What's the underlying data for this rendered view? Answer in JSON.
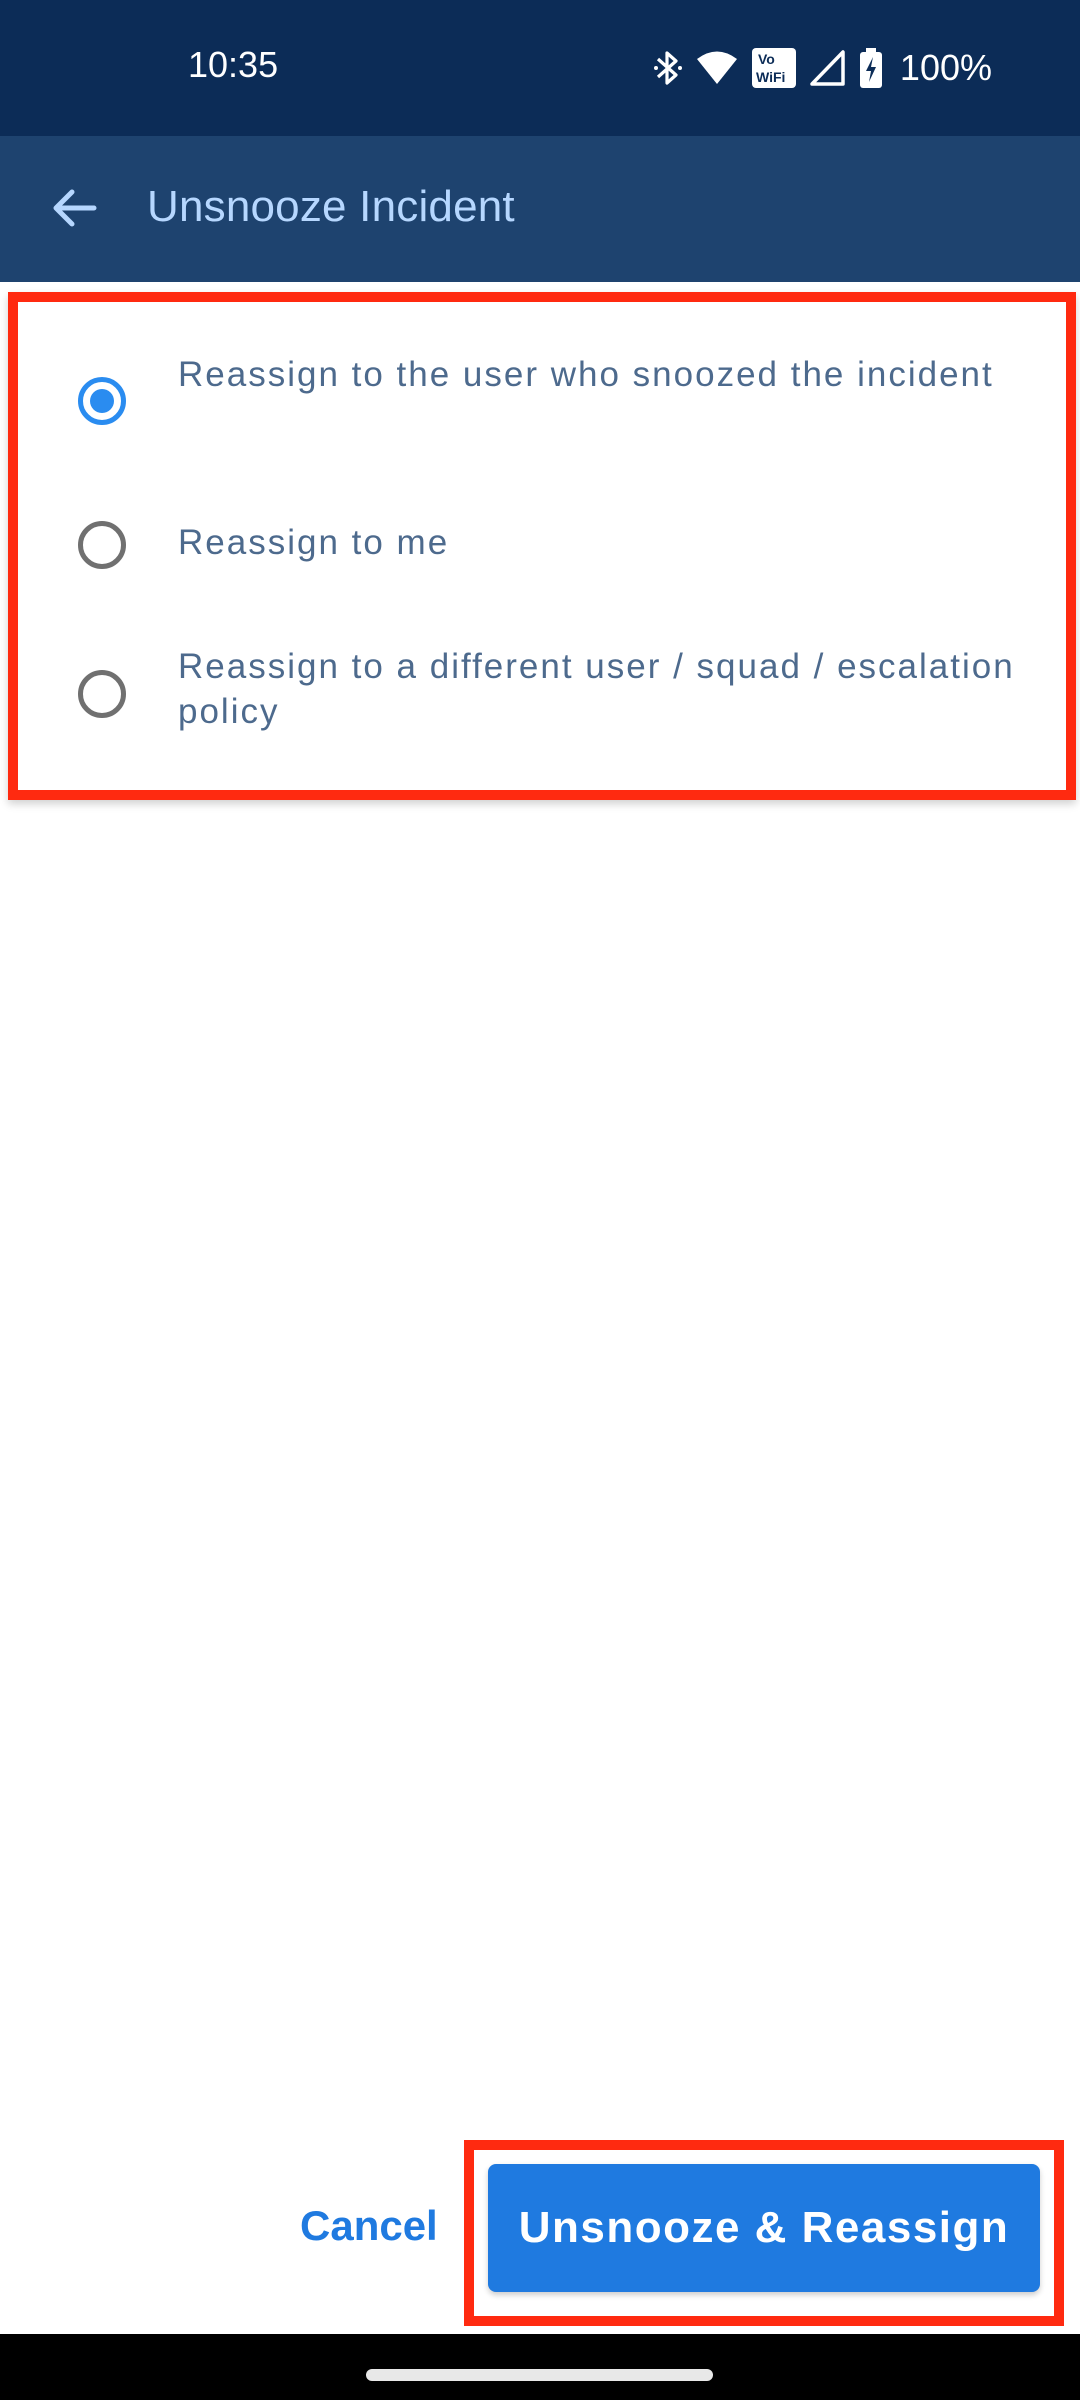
{
  "status_bar": {
    "time": "10:35",
    "icons": [
      "bluetooth-icon",
      "wifi-icon",
      "vowifi-icon",
      "signal-icon",
      "battery-charging-icon"
    ],
    "vowifi_top": "Vo",
    "vowifi_bottom": "WiFi",
    "battery": "100%"
  },
  "app_bar": {
    "title": "Unsnooze Incident",
    "back_icon": "arrow-back-icon"
  },
  "options": [
    {
      "label": "Reassign to the user who snoozed the incident",
      "checked": true
    },
    {
      "label": "Reassign to me",
      "checked": false
    },
    {
      "label": "Reassign to a different user / squad / escalation policy",
      "checked": false
    }
  ],
  "actions": {
    "cancel_label": "Cancel",
    "primary_label": "Unsnooze & Reassign"
  },
  "colors": {
    "status_bar_bg": "#0c2c57",
    "app_bar_bg": "#1e436f",
    "accent": "#1f7ae0",
    "highlight": "#ff2a10"
  }
}
